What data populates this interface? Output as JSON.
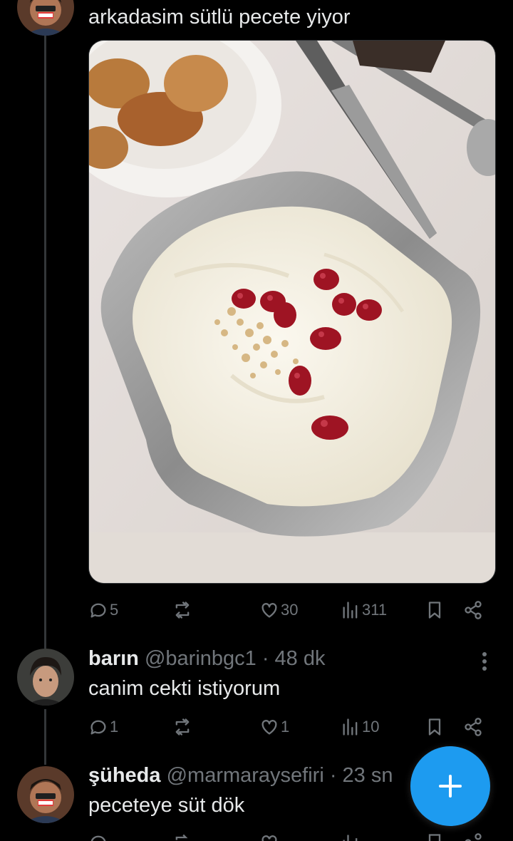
{
  "colors": {
    "background": "#000000",
    "text": "#e7e9ea",
    "muted": "#71767b",
    "accent": "#1d9bf0",
    "thread_line": "#333639"
  },
  "main_tweet": {
    "text": "arkadasim sütlü pecete yiyor",
    "media_description": "photo-muhallebi-with-pomegranate",
    "stats": {
      "replies": "5",
      "retweets": "",
      "likes": "30",
      "views": "311"
    }
  },
  "replies": [
    {
      "name": "barın",
      "handle": "@barinbgc1",
      "time": "· 48 dk",
      "text": "canim cekti istiyorum",
      "stats": {
        "replies": "1",
        "retweets": "",
        "likes": "1",
        "views": "10"
      }
    },
    {
      "name": "şüheda",
      "handle": "@marmaraysefiri",
      "time": "· 23 sn",
      "text": "peceteye süt dök"
    }
  ],
  "icons": {
    "reply": "reply-icon",
    "retweet": "retweet-icon",
    "like": "heart-icon",
    "views": "views-icon",
    "bookmark": "bookmark-icon",
    "share": "share-icon",
    "more": "more-icon",
    "compose": "compose-plus-icon"
  }
}
